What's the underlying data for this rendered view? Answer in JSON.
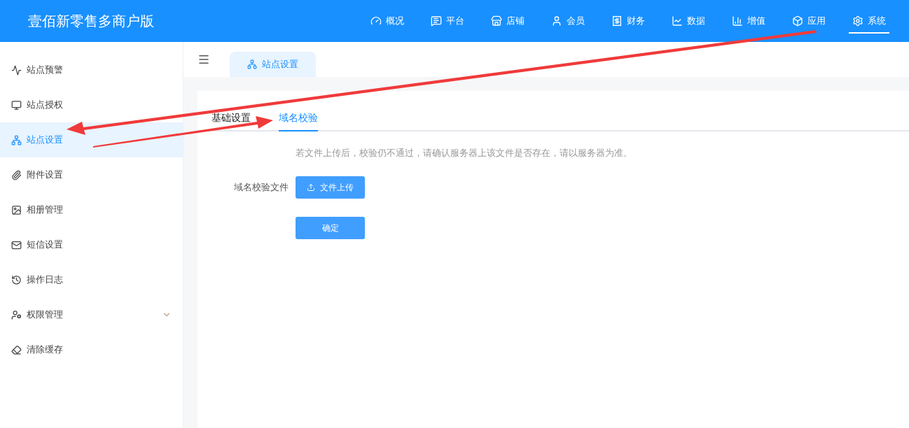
{
  "header": {
    "brand": "壹佰新零售多商户版",
    "nav": [
      {
        "label": "概况",
        "selected": false
      },
      {
        "label": "平台",
        "selected": false
      },
      {
        "label": "店铺",
        "selected": false
      },
      {
        "label": "会员",
        "selected": false
      },
      {
        "label": "财务",
        "selected": false
      },
      {
        "label": "数据",
        "selected": false
      },
      {
        "label": "增值",
        "selected": false
      },
      {
        "label": "应用",
        "selected": false
      },
      {
        "label": "系统",
        "selected": true
      }
    ]
  },
  "sidebar": {
    "items": [
      {
        "label": "站点预警",
        "selected": false,
        "kind": "link"
      },
      {
        "label": "站点授权",
        "selected": false,
        "kind": "link"
      },
      {
        "label": "站点设置",
        "selected": true,
        "kind": "link"
      },
      {
        "label": "附件设置",
        "selected": false,
        "kind": "link"
      },
      {
        "label": "相册管理",
        "selected": false,
        "kind": "link"
      },
      {
        "label": "短信设置",
        "selected": false,
        "kind": "link"
      },
      {
        "label": "操作日志",
        "selected": false,
        "kind": "link"
      },
      {
        "label": "权限管理",
        "selected": false,
        "kind": "submenu"
      },
      {
        "label": "清除缓存",
        "selected": false,
        "kind": "link"
      }
    ]
  },
  "page_tabs": [
    {
      "label": "站点设置",
      "selected": true
    }
  ],
  "content": {
    "tabs": [
      {
        "label": "基础设置",
        "selected": false
      },
      {
        "label": "域名校验",
        "selected": true
      }
    ],
    "hint": "若文件上传后，校验仍不通过，请确认服务器上该文件是否存在，请以服务器为准。",
    "field_label": "域名校验文件",
    "upload_button": "文件上传",
    "submit_button": "确定"
  }
}
